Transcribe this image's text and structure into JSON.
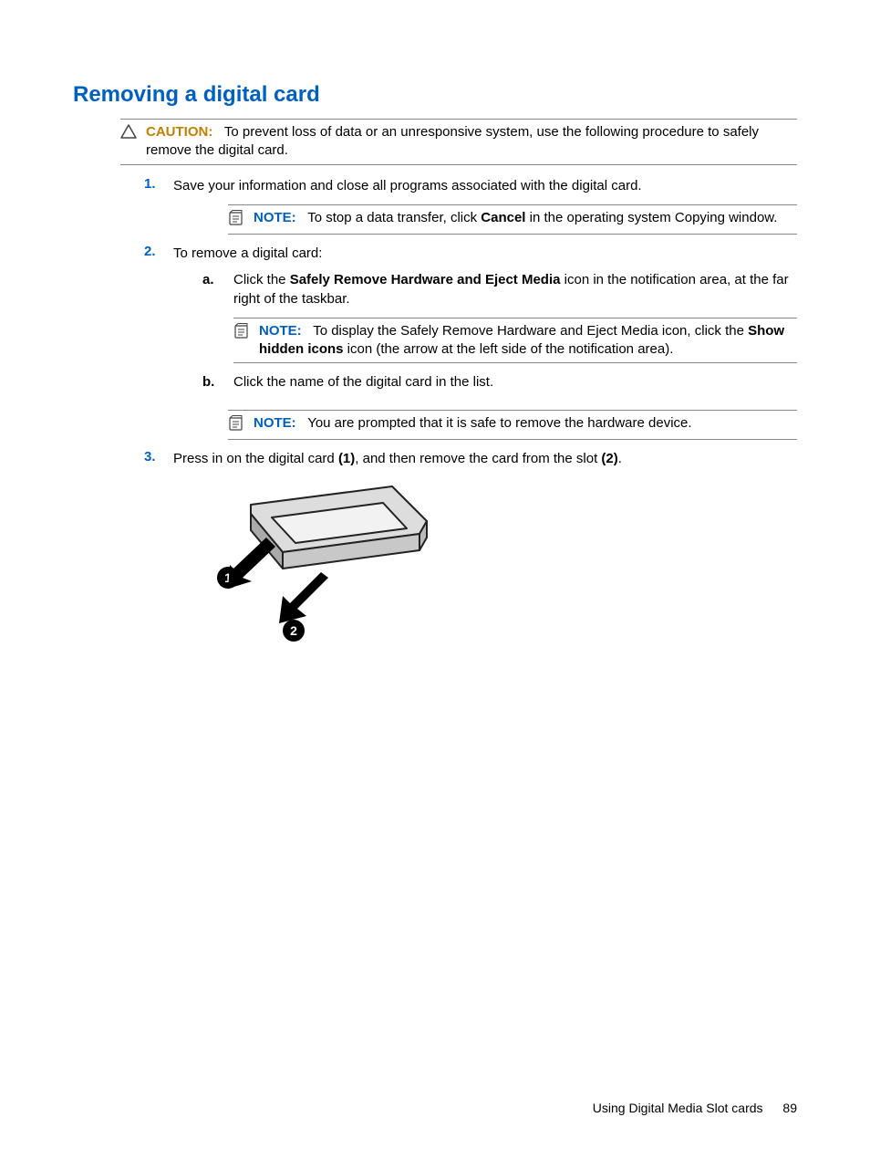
{
  "title": "Removing a digital card",
  "caution": {
    "label": "CAUTION:",
    "text": "To prevent loss of data or an unresponsive system, use the following procedure to safely remove the digital card."
  },
  "steps": {
    "s1": {
      "num": "1.",
      "text": "Save your information and close all programs associated with the digital card."
    },
    "note1": {
      "label": "NOTE:",
      "pre": "To stop a data transfer, click ",
      "bold": "Cancel",
      "post": " in the operating system Copying window."
    },
    "s2": {
      "num": "2.",
      "text": "To remove a digital card:",
      "a": {
        "letter": "a.",
        "pre": "Click the ",
        "bold": "Safely Remove Hardware and Eject Media",
        "post": " icon in the notification area, at the far right of the taskbar."
      },
      "note2": {
        "label": "NOTE:",
        "pre": "To display the Safely Remove Hardware and Eject Media icon, click the ",
        "bold": "Show hidden icons",
        "post": " icon (the arrow at the left side of the notification area)."
      },
      "b": {
        "letter": "b.",
        "text": "Click the name of the digital card in the list."
      }
    },
    "note3": {
      "label": "NOTE:",
      "text": "You are prompted that it is safe to remove the hardware device."
    },
    "s3": {
      "num": "3.",
      "pre": "Press in on the digital card ",
      "b1": "(1)",
      "mid": ", and then remove the card from the slot ",
      "b2": "(2)",
      "post": "."
    }
  },
  "footer": {
    "section": "Using Digital Media Slot cards",
    "page": "89"
  }
}
